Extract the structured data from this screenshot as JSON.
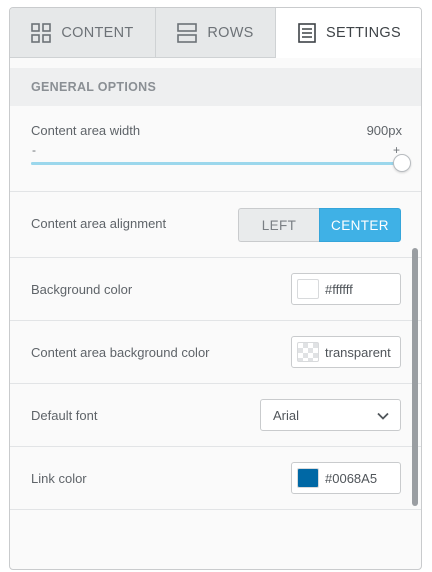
{
  "tabs": [
    {
      "label": "CONTENT",
      "icon": "grid-icon",
      "active": false
    },
    {
      "label": "ROWS",
      "icon": "rows-icon",
      "active": false
    },
    {
      "label": "SETTINGS",
      "icon": "settings-list-icon",
      "active": true
    }
  ],
  "section": {
    "title": "GENERAL OPTIONS"
  },
  "content_width": {
    "label": "Content area width",
    "value": "900px",
    "slider_min_label": "-",
    "slider_max_label": "+",
    "slider_fraction": 1.0
  },
  "alignment": {
    "label": "Content area alignment",
    "options": [
      "LEFT",
      "CENTER"
    ],
    "selected": "CENTER"
  },
  "background_color": {
    "label": "Background color",
    "value": "#ffffff",
    "swatch": "#ffffff"
  },
  "content_bg_color": {
    "label": "Content area background color",
    "value": "transparent",
    "swatch": "transparent"
  },
  "default_font": {
    "label": "Default font",
    "value": "Arial"
  },
  "link_color": {
    "label": "Link color",
    "value": "#0068A5",
    "swatch": "#0068A5"
  },
  "colors": {
    "accent": "#3fb1e6",
    "slider_fill": "#9bd7ec",
    "tab_bg": "#e6e8e9"
  }
}
